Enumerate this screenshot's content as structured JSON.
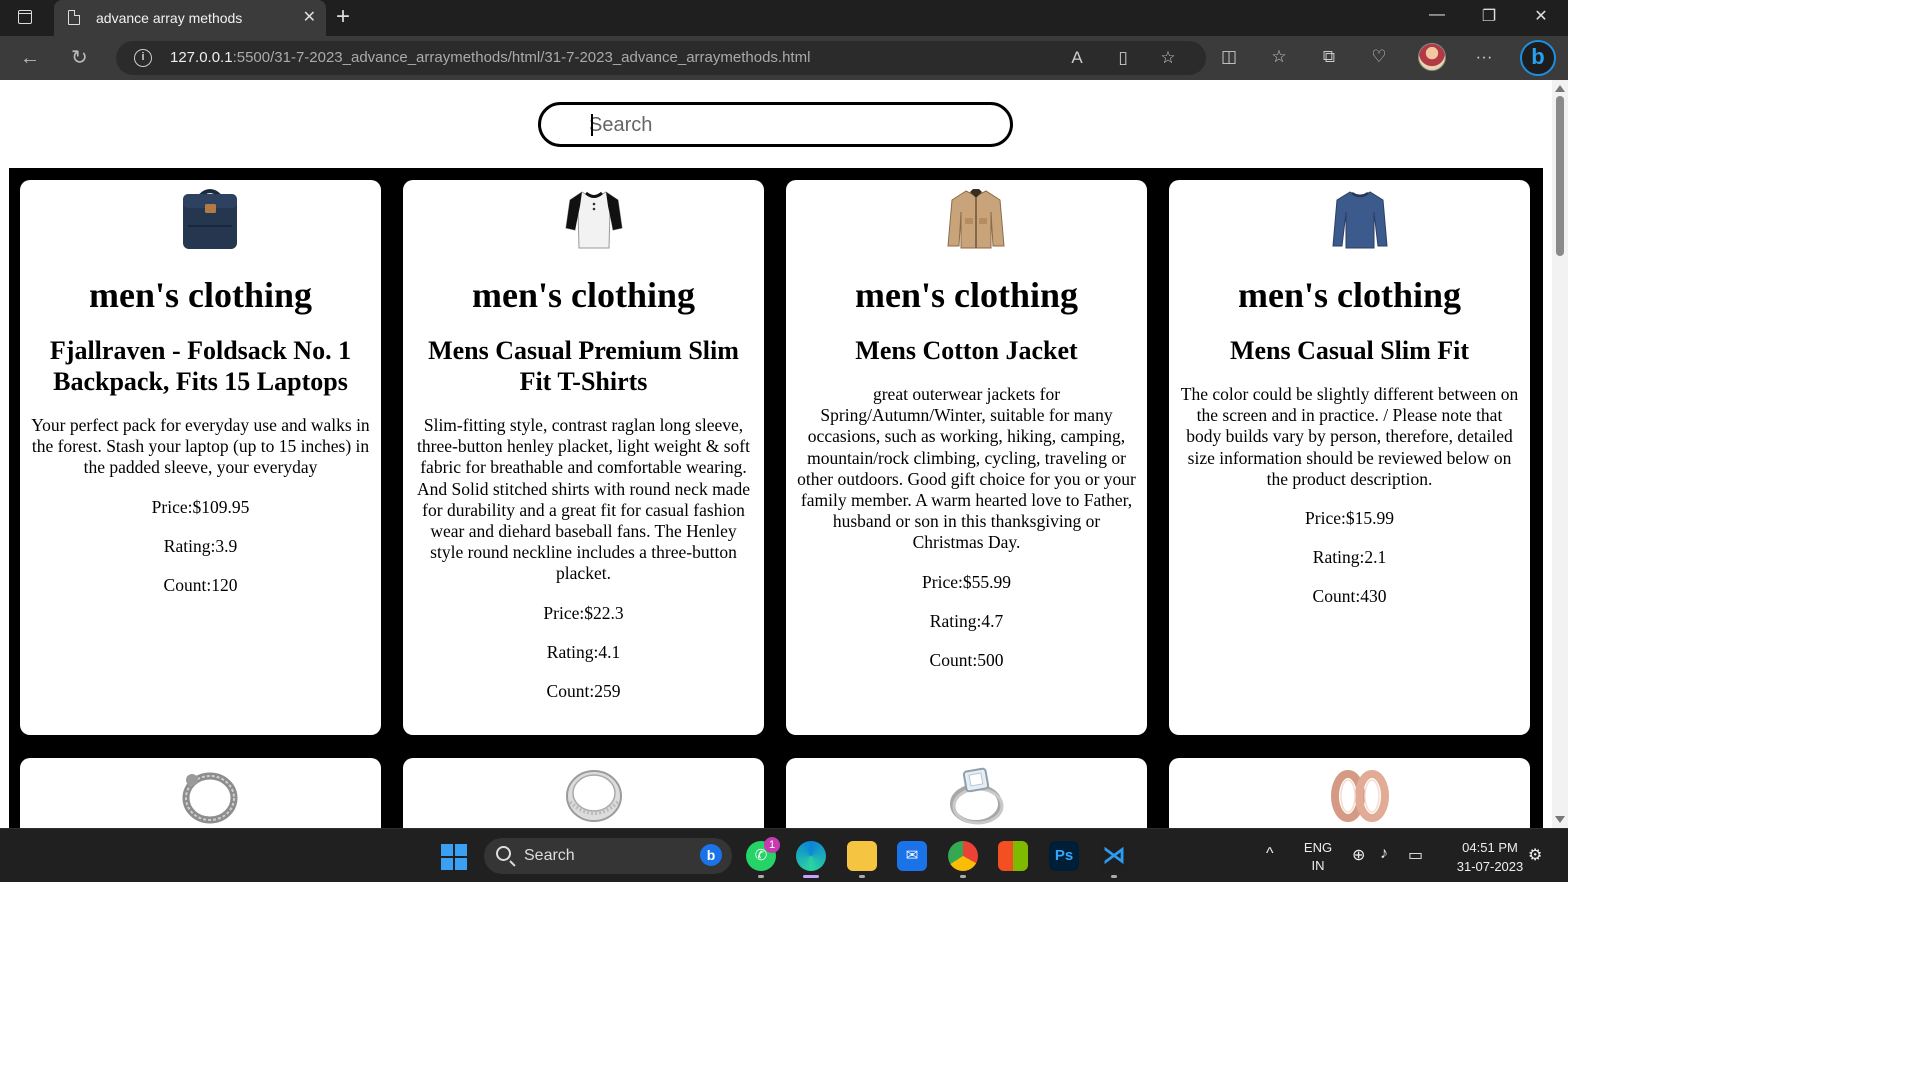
{
  "browser": {
    "tab_title": "advance array methods",
    "url_host": "127.0.0.1",
    "url_path": ":5500/31-7-2023_advance_arraymethods/html/31-7-2023_advance_arraymethods.html",
    "new_tab_glyph": "+",
    "close_glyph": "✕"
  },
  "page": {
    "search_placeholder": "Search"
  },
  "products": [
    {
      "category": "men's clothing",
      "title": "Fjallraven - Foldsack No. 1 Backpack, Fits 15 Laptops",
      "description": "Your perfect pack for everyday use and walks in the forest. Stash your laptop (up to 15 inches) in the padded sleeve, your everyday",
      "price": "Price:$109.95",
      "rating": "Rating:3.9",
      "count": "Count:120",
      "image": "backpack-image"
    },
    {
      "category": "men's clothing",
      "title": "Mens Casual Premium Slim Fit T-Shirts",
      "description": "Slim-fitting style, contrast raglan long sleeve, three-button henley placket, light weight & soft fabric for breathable and comfortable wearing. And Solid stitched shirts with round neck made for durability and a great fit for casual fashion wear and diehard baseball fans. The Henley style round neckline includes a three-button placket.",
      "price": "Price:$22.3",
      "rating": "Rating:4.1",
      "count": "Count:259",
      "image": "tshirt-image"
    },
    {
      "category": "men's clothing",
      "title": "Mens Cotton Jacket",
      "description": "great outerwear jackets for Spring/Autumn/Winter, suitable for many occasions, such as working, hiking, camping, mountain/rock climbing, cycling, traveling or other outdoors. Good gift choice for you or your family member. A warm hearted love to Father, husband or son in this thanksgiving or Christmas Day.",
      "price": "Price:$55.99",
      "rating": "Rating:4.7",
      "count": "Count:500",
      "image": "jacket-image"
    },
    {
      "category": "men's clothing",
      "title": "Mens Casual Slim Fit",
      "description": "The color could be slightly different between on the screen and in practice. / Please note that body builds vary by person, therefore, detailed size information should be reviewed below on the product description.",
      "price": "Price:$15.99",
      "rating": "Rating:2.1",
      "count": "Count:430",
      "image": "longsleeve-image"
    }
  ],
  "next_row_images": [
    "bracelet-image",
    "silver-ring-image",
    "diamond-ring-image",
    "rose-gold-rings-image"
  ],
  "taskbar": {
    "search_label": "Search",
    "whatsapp_badge": "1",
    "photoshop_label": "Ps",
    "language_line1": "ENG",
    "language_line2": "IN",
    "time": "04:51 PM",
    "date": "31-07-2023",
    "tray_chevron": "^"
  },
  "colors": {
    "page_grid_bg": "#000000",
    "card_bg": "#ffffff",
    "chrome_dark": "#1f1f1f",
    "chrome_mid": "#3b3b3b",
    "edge_accent": "#1d8fe1"
  }
}
